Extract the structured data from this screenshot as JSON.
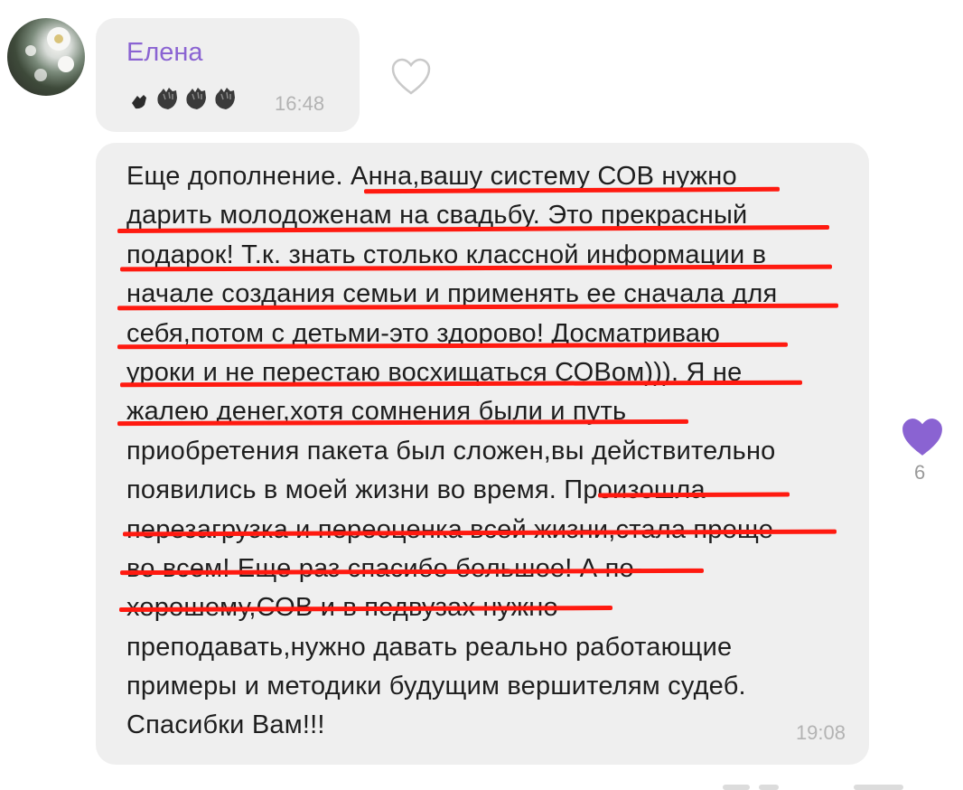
{
  "messages": [
    {
      "sender": "Елена",
      "time": "16:48",
      "content_icons": [
        "hand-icon",
        "hand-icon",
        "hand-icon",
        "hand-icon"
      ]
    },
    {
      "time": "19:08",
      "lines": [
        "Еще дополнение. Анна,вашу систему СОВ нужно",
        "дарить молодоженам на свадьбу. Это прекрасный",
        "подарок! Т.к. знать столько классной информации в",
        "начале создания семьи и применять ее сначала для",
        "себя,потом с детьми-это здорово! Досматриваю",
        "уроки и не перестаю восхищаться СОВом))). Я не",
        "жалею денег,хотя сомнения были и путь",
        "приобретения пакета был сложен,вы действительно",
        "появились в моей жизни во время. Произошла",
        "перезагрузка и переоценка всей жизни,стала проще",
        "во всем! Еще раз спасибо большое! А по-",
        "хорошему,СОВ и в педвузах нужно",
        "преподавать,нужно давать реально работающие",
        "примеры и методики будущим вершителям судеб.",
        "Спасибки Вам!!!"
      ],
      "likes": "6"
    }
  ],
  "colors": {
    "sender_name": "#8a63d2",
    "bubble": "#efefef",
    "underline": "#ff1a10",
    "like_heart": "#8a63d2",
    "timestamp": "#b3b3b3"
  }
}
